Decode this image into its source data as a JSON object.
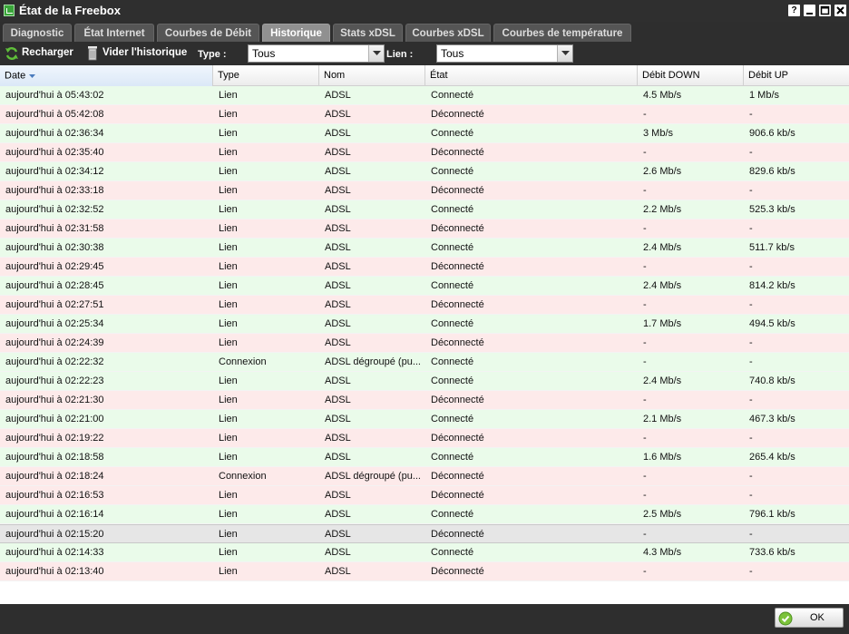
{
  "window": {
    "title": "État de la Freebox",
    "buttons": [
      "?",
      "–",
      "□",
      "✕"
    ]
  },
  "tabs": [
    {
      "label": "Diagnostic",
      "active": false
    },
    {
      "label": "État Internet",
      "active": false
    },
    {
      "label": "Courbes de Débit",
      "active": false
    },
    {
      "label": "Historique",
      "active": true
    },
    {
      "label": "Stats xDSL",
      "active": false
    },
    {
      "label": "Courbes xDSL",
      "active": false
    },
    {
      "label": "Courbes de température",
      "active": false
    }
  ],
  "toolbar": {
    "reload_label": "Recharger",
    "clear_label": "Vider l'historique",
    "type_label": "Type :",
    "type_value": "Tous",
    "link_label": "Lien :",
    "link_value": "Tous"
  },
  "columns": [
    "Date",
    "Type",
    "Nom",
    "État",
    "Débit DOWN",
    "Débit UP"
  ],
  "rows": [
    {
      "date": "aujourd'hui à 05:43:02",
      "type": "Lien",
      "nom": "ADSL",
      "etat": "Connecté",
      "down": "4.5 Mb/s",
      "up": "1 Mb/s",
      "status": "ok"
    },
    {
      "date": "aujourd'hui à 05:42:08",
      "type": "Lien",
      "nom": "ADSL",
      "etat": "Déconnecté",
      "down": "-",
      "up": "-",
      "status": "ko"
    },
    {
      "date": "aujourd'hui à 02:36:34",
      "type": "Lien",
      "nom": "ADSL",
      "etat": "Connecté",
      "down": "3 Mb/s",
      "up": "906.6 kb/s",
      "status": "ok"
    },
    {
      "date": "aujourd'hui à 02:35:40",
      "type": "Lien",
      "nom": "ADSL",
      "etat": "Déconnecté",
      "down": "-",
      "up": "-",
      "status": "ko"
    },
    {
      "date": "aujourd'hui à 02:34:12",
      "type": "Lien",
      "nom": "ADSL",
      "etat": "Connecté",
      "down": "2.6 Mb/s",
      "up": "829.6 kb/s",
      "status": "ok"
    },
    {
      "date": "aujourd'hui à 02:33:18",
      "type": "Lien",
      "nom": "ADSL",
      "etat": "Déconnecté",
      "down": "-",
      "up": "-",
      "status": "ko"
    },
    {
      "date": "aujourd'hui à 02:32:52",
      "type": "Lien",
      "nom": "ADSL",
      "etat": "Connecté",
      "down": "2.2 Mb/s",
      "up": "525.3 kb/s",
      "status": "ok"
    },
    {
      "date": "aujourd'hui à 02:31:58",
      "type": "Lien",
      "nom": "ADSL",
      "etat": "Déconnecté",
      "down": "-",
      "up": "-",
      "status": "ko"
    },
    {
      "date": "aujourd'hui à 02:30:38",
      "type": "Lien",
      "nom": "ADSL",
      "etat": "Connecté",
      "down": "2.4 Mb/s",
      "up": "511.7 kb/s",
      "status": "ok"
    },
    {
      "date": "aujourd'hui à 02:29:45",
      "type": "Lien",
      "nom": "ADSL",
      "etat": "Déconnecté",
      "down": "-",
      "up": "-",
      "status": "ko"
    },
    {
      "date": "aujourd'hui à 02:28:45",
      "type": "Lien",
      "nom": "ADSL",
      "etat": "Connecté",
      "down": "2.4 Mb/s",
      "up": "814.2 kb/s",
      "status": "ok"
    },
    {
      "date": "aujourd'hui à 02:27:51",
      "type": "Lien",
      "nom": "ADSL",
      "etat": "Déconnecté",
      "down": "-",
      "up": "-",
      "status": "ko"
    },
    {
      "date": "aujourd'hui à 02:25:34",
      "type": "Lien",
      "nom": "ADSL",
      "etat": "Connecté",
      "down": "1.7 Mb/s",
      "up": "494.5 kb/s",
      "status": "ok"
    },
    {
      "date": "aujourd'hui à 02:24:39",
      "type": "Lien",
      "nom": "ADSL",
      "etat": "Déconnecté",
      "down": "-",
      "up": "-",
      "status": "ko"
    },
    {
      "date": "aujourd'hui à 02:22:32",
      "type": "Connexion",
      "nom": "ADSL dégroupé (pu...",
      "etat": "Connecté",
      "down": "-",
      "up": "-",
      "status": "ok"
    },
    {
      "date": "aujourd'hui à 02:22:23",
      "type": "Lien",
      "nom": "ADSL",
      "etat": "Connecté",
      "down": "2.4 Mb/s",
      "up": "740.8 kb/s",
      "status": "ok"
    },
    {
      "date": "aujourd'hui à 02:21:30",
      "type": "Lien",
      "nom": "ADSL",
      "etat": "Déconnecté",
      "down": "-",
      "up": "-",
      "status": "ko"
    },
    {
      "date": "aujourd'hui à 02:21:00",
      "type": "Lien",
      "nom": "ADSL",
      "etat": "Connecté",
      "down": "2.1 Mb/s",
      "up": "467.3 kb/s",
      "status": "ok"
    },
    {
      "date": "aujourd'hui à 02:19:22",
      "type": "Lien",
      "nom": "ADSL",
      "etat": "Déconnecté",
      "down": "-",
      "up": "-",
      "status": "ko"
    },
    {
      "date": "aujourd'hui à 02:18:58",
      "type": "Lien",
      "nom": "ADSL",
      "etat": "Connecté",
      "down": "1.6 Mb/s",
      "up": "265.4 kb/s",
      "status": "ok"
    },
    {
      "date": "aujourd'hui à 02:18:24",
      "type": "Connexion",
      "nom": "ADSL dégroupé (pu...",
      "etat": "Déconnecté",
      "down": "-",
      "up": "-",
      "status": "ko"
    },
    {
      "date": "aujourd'hui à 02:16:53",
      "type": "Lien",
      "nom": "ADSL",
      "etat": "Déconnecté",
      "down": "-",
      "up": "-",
      "status": "ko"
    },
    {
      "date": "aujourd'hui à 02:16:14",
      "type": "Lien",
      "nom": "ADSL",
      "etat": "Connecté",
      "down": "2.5 Mb/s",
      "up": "796.1 kb/s",
      "status": "ok"
    },
    {
      "date": "aujourd'hui à 02:15:20",
      "type": "Lien",
      "nom": "ADSL",
      "etat": "Déconnecté",
      "down": "-",
      "up": "-",
      "status": "sel"
    },
    {
      "date": "aujourd'hui à 02:14:33",
      "type": "Lien",
      "nom": "ADSL",
      "etat": "Connecté",
      "down": "4.3 Mb/s",
      "up": "733.6 kb/s",
      "status": "ok"
    },
    {
      "date": "aujourd'hui à 02:13:40",
      "type": "Lien",
      "nom": "ADSL",
      "etat": "Déconnecté",
      "down": "-",
      "up": "-",
      "status": "ko"
    }
  ],
  "footer": {
    "ok_label": "OK"
  },
  "colors": {
    "connected_row": "#eafbea",
    "disconnected_row": "#fdeaea",
    "selected_row": "#e6e6e6",
    "accent": "#3aa63a"
  }
}
